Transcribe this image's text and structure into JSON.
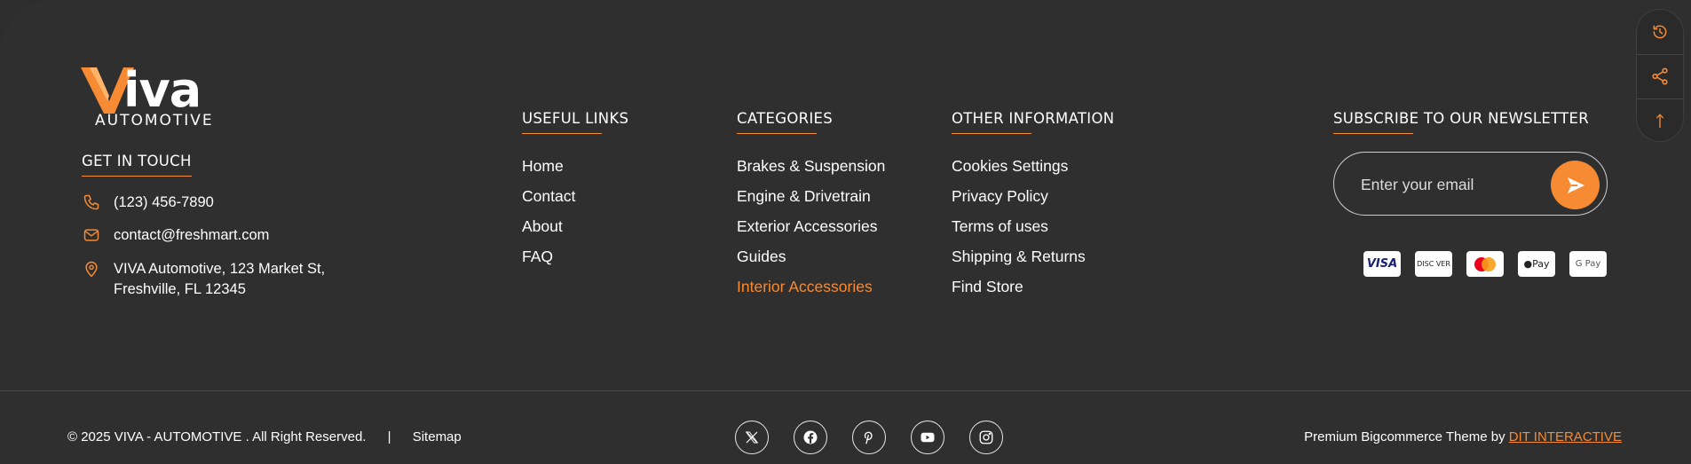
{
  "brand": {
    "name": "iva",
    "subtitle": "AUTOMOTIVE",
    "accent": "#f68b33",
    "background": "#2f2f2f"
  },
  "contact": {
    "heading": "GET IN TOUCH",
    "phone": "(123) 456-7890",
    "email": "contact@freshmart.com",
    "address_line1": "VIVA Automotive, 123 Market St,",
    "address_line2": "Freshville, FL 12345",
    "icons": [
      "phone-icon",
      "mail-icon",
      "location-pin-icon"
    ]
  },
  "useful_links": {
    "heading": "USEFUL LINKS",
    "items": [
      "Home",
      "Contact",
      "About",
      "FAQ"
    ]
  },
  "categories": {
    "heading": "CATEGORIES",
    "items": [
      "Brakes & Suspension",
      "Engine & Drivetrain",
      "Exterior Accessories",
      "Guides",
      "Interior Accessories"
    ],
    "active": "Interior Accessories"
  },
  "other_information": {
    "heading": "OTHER INFORMATION",
    "items": [
      "Cookies Settings",
      "Privacy Policy",
      "Terms of uses",
      "Shipping & Returns",
      "Find Store"
    ]
  },
  "newsletter": {
    "heading": "SUBSCRIBE TO OUR NEWSLETTER",
    "placeholder": "Enter your email",
    "value": ""
  },
  "payments": {
    "visa": "VISA",
    "discover": "DISC VER",
    "apple_pay": "Pay",
    "google_pay": "G Pay",
    "icons": [
      "visa-icon",
      "discover-icon",
      "mastercard-icon",
      "apple-pay-icon",
      "google-pay-icon"
    ]
  },
  "side_tools": [
    "history-icon",
    "share-icon",
    "arrow-up-icon"
  ],
  "bottom": {
    "copyright": "© 2025 VIVA - AUTOMOTIVE . All Right Reserved.",
    "separator": "|",
    "sitemap": "Sitemap",
    "credit_prefix": "Premium Bigcommerce Theme by",
    "credit_link": "DIT INTERACTIVE",
    "socials": [
      "x-icon",
      "facebook-icon",
      "pinterest-icon",
      "youtube-icon",
      "instagram-icon"
    ]
  }
}
